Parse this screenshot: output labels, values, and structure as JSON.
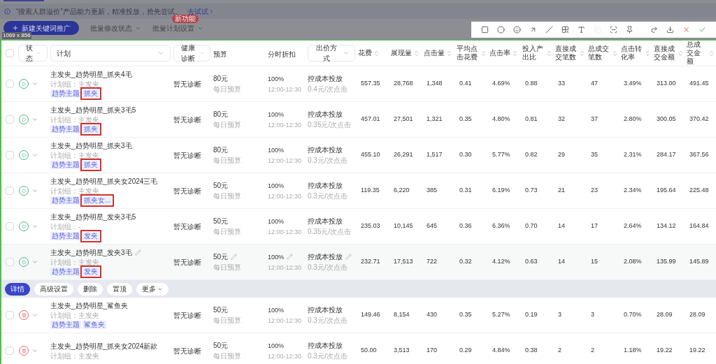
{
  "notice": {
    "text": "“搜索人群溢价”产品能力更新，精准投放，抢先尝试。",
    "link": "去试试"
  },
  "actions_bar": [
    {
      "label": "新建关键词推广",
      "kind": "primary"
    },
    {
      "label": "批量修改状态",
      "kind": "dropdown"
    },
    {
      "label": "批量计划设置",
      "kind": "dropdown",
      "badge": "新功能"
    }
  ],
  "selection_size": "1069 x 856",
  "capture_tools": [
    {
      "kind": "rectangle",
      "disabled": false
    },
    {
      "kind": "ellipse",
      "disabled": false
    },
    {
      "kind": "emoji",
      "disabled": false
    },
    {
      "kind": "arrow",
      "disabled": false
    },
    {
      "kind": "pen",
      "disabled": false
    },
    {
      "kind": "mosaic",
      "disabled": false
    },
    {
      "kind": "text",
      "disabled": false
    },
    {
      "kind": "copy",
      "disabled": true
    },
    {
      "kind": "scan",
      "disabled": false
    },
    {
      "kind": "pin",
      "disabled": false
    },
    {
      "kind": "redo",
      "disabled": false
    },
    {
      "kind": "save",
      "disabled": false
    },
    {
      "kind": "cancel",
      "disabled": false
    },
    {
      "kind": "done",
      "disabled": false
    }
  ],
  "table": {
    "select_all": {
      "checked": false
    },
    "columns": [
      {
        "label": "状态",
        "kind": "select"
      },
      {
        "label": "计划",
        "kind": "select"
      },
      {
        "label": "健康诊断",
        "kind": "select"
      },
      {
        "label": "预算",
        "kind": "plain"
      },
      {
        "label": "分时折扣",
        "kind": "plain"
      },
      {
        "label": "出价方式",
        "kind": "select"
      },
      {
        "label": "花费",
        "kind": "sort"
      },
      {
        "label": "展现量",
        "kind": "sort"
      },
      {
        "label": "点击量",
        "kind": "sort"
      },
      {
        "label": "平均点击花费",
        "kind": "sort"
      },
      {
        "label": "点击率",
        "kind": "sort"
      },
      {
        "label": "投入产出比",
        "kind": "sort"
      },
      {
        "label": "直接成交笔数",
        "kind": "sort"
      },
      {
        "label": "总成交笔数",
        "kind": "sort"
      },
      {
        "label": "点击转化率",
        "kind": "sort"
      },
      {
        "label": "直接成交金额",
        "kind": "sort"
      },
      {
        "label": "总成交金额",
        "kind": "sort"
      }
    ],
    "rows": [
      {
        "paused": false,
        "hovered": false,
        "name": "主发夹_趋势明星_抓夹4毛",
        "group": "计划组：主发夹",
        "tags": [
          {
            "label": "趋势主题",
            "annotated": false
          },
          {
            "label": "抓夹",
            "annotated": true
          }
        ],
        "health": "暂无诊断",
        "budget": "80元",
        "budget_note": "每日预算",
        "discount": "100%",
        "discount_time": "12:00-12:30",
        "bid": "控成本投放",
        "bid_note": "0.4元/次点击",
        "metrics": [
          "557.35",
          "28,768",
          "1,348",
          "0.41",
          "4.69%",
          "0.88",
          "33",
          "47",
          "3.49%",
          "313.00",
          "491.45"
        ]
      },
      {
        "paused": false,
        "hovered": false,
        "name": "主发夹_趋势明星_抓夹3毛5",
        "group": "计划组：主发夹",
        "tags": [
          {
            "label": "趋势主题",
            "annotated": false
          },
          {
            "label": "抓夹",
            "annotated": true
          }
        ],
        "health": "暂无诊断",
        "budget": "80元",
        "budget_note": "每日预算",
        "discount": "100%",
        "discount_time": "12:00-12:30",
        "bid": "控成本投放",
        "bid_note": "0.35元/次点击",
        "metrics": [
          "457.01",
          "27,501",
          "1,321",
          "0.35",
          "4.80%",
          "0.81",
          "32",
          "37",
          "2.80%",
          "300.05",
          "370.42"
        ]
      },
      {
        "paused": false,
        "hovered": false,
        "name": "主发夹_趋势明星_抓夹3毛",
        "group": "计划组：主发夹",
        "tags": [
          {
            "label": "趋势主题",
            "annotated": false
          },
          {
            "label": "抓夹",
            "annotated": true
          }
        ],
        "health": "暂无诊断",
        "budget": "80元",
        "budget_note": "每日预算",
        "discount": "100%",
        "discount_time": "12:00-12:30",
        "bid": "控成本投放",
        "bid_note": "0.3元/次点击",
        "metrics": [
          "455.10",
          "26,291",
          "1,517",
          "0.30",
          "5.77%",
          "0.82",
          "29",
          "35",
          "2.31%",
          "284.17",
          "367.56"
        ]
      },
      {
        "paused": false,
        "hovered": false,
        "name": "主发夹_趋势明星_抓夹女2024三毛",
        "group": "计划组：主发夹",
        "tags": [
          {
            "label": "趋势主题",
            "annotated": false
          },
          {
            "label": "抓夹女...",
            "annotated": true
          }
        ],
        "health": "暂无诊断",
        "budget": "50元",
        "budget_note": "每日预算",
        "discount": "100%",
        "discount_time": "12:00-12:30",
        "bid": "控成本投放",
        "bid_note": "0.3元/次点击",
        "metrics": [
          "119.35",
          "6,220",
          "385",
          "0.31",
          "6.19%",
          "0.73",
          "21",
          "23",
          "2.34%",
          "195.64",
          "225.48"
        ]
      },
      {
        "paused": false,
        "hovered": false,
        "name": "主发夹_趋势明星_发夹3毛5",
        "group": "计划组：-",
        "tags": [
          {
            "label": "趋势主题",
            "annotated": false
          },
          {
            "label": "发夹",
            "annotated": true
          }
        ],
        "health": "暂无诊断",
        "budget": "50元",
        "budget_note": "每日预算",
        "discount": "100%",
        "discount_time": "12:00-12:30",
        "bid": "控成本投放",
        "bid_note": "0.35元/次点击",
        "metrics": [
          "235.03",
          "10,145",
          "645",
          "0.36",
          "6.36%",
          "0.70",
          "14",
          "17",
          "2.64%",
          "134.12",
          "164.84"
        ]
      },
      {
        "paused": false,
        "hovered": true,
        "name": "主发夹_趋势明星_发夹3毛",
        "group": "计划组：主发夹",
        "tags": [
          {
            "label": "趋势主题",
            "annotated": false
          },
          {
            "label": "发夹",
            "annotated": true
          }
        ],
        "health": "暂无诊断",
        "budget": "50元",
        "budget_note": "每日预算",
        "discount": "100%",
        "discount_time": "12:00-12:30",
        "bid": "控成本投放",
        "bid_note": "0.3元/次点击",
        "metrics": [
          "232.71",
          "17,513",
          "722",
          "0.32",
          "4.12%",
          "0.63",
          "14",
          "15",
          "2.08%",
          "135.99",
          "145.89"
        ],
        "actions": [
          {
            "label": "详情",
            "selected": true
          },
          {
            "label": "高级设置",
            "selected": false
          },
          {
            "label": "删除",
            "selected": false
          },
          {
            "label": "置顶",
            "selected": false
          },
          {
            "label": "更多",
            "selected": false
          }
        ]
      },
      {
        "paused": true,
        "hovered": false,
        "name": "主发夹_趋势明星_鲨鱼夹",
        "group": "计划组：主发夹",
        "tags": [
          {
            "label": "趋势主题",
            "annotated": false
          },
          {
            "label": "鲨鱼夹",
            "annotated": false
          }
        ],
        "health": "暂无诊断",
        "budget": "50元",
        "budget_note": "每日预算",
        "discount": "100%",
        "discount_time": "12:00-12:30",
        "bid": "控成本投放",
        "bid_note": "0.3元/次点击",
        "metrics": [
          "149.46",
          "8,154",
          "430",
          "0.35",
          "5.27%",
          "0.19",
          "3",
          "3",
          "0.70%",
          "28.09",
          "28.09"
        ]
      },
      {
        "paused": true,
        "hovered": false,
        "name": "主发夹_趋势明星_抓夹女2024新款",
        "group": "计划组：主发夹",
        "tags": [],
        "health": "暂无诊断",
        "budget": "50元",
        "budget_note": "每日预算",
        "discount": "100%",
        "discount_time": "12:00-12:30",
        "bid": "控成本投放",
        "bid_note": "0.3元/次点击",
        "metrics": [
          "50.00",
          "3,513",
          "170",
          "0.29",
          "4.84%",
          "0.38",
          "2",
          "2",
          "1.18%",
          "19.22",
          "19.22"
        ]
      }
    ]
  }
}
